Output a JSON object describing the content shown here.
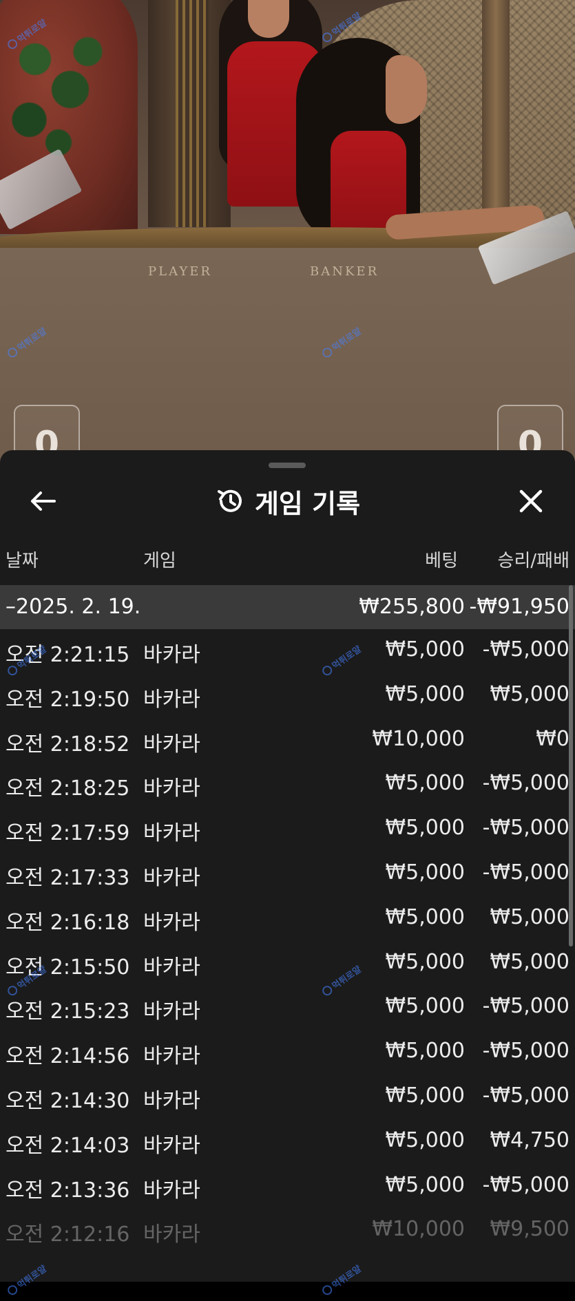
{
  "video": {
    "table_labels": {
      "player": "PLAYER",
      "banker": "BANKER"
    },
    "scores": {
      "left": "0",
      "right": "0"
    }
  },
  "watermark_text": "먹튀로얄",
  "sheet": {
    "title": "게임 기록",
    "back_icon": "arrow-left-icon",
    "history_icon": "history-icon",
    "close_icon": "close-icon",
    "columns": {
      "date": "날짜",
      "game": "게임",
      "bet": "베팅",
      "result": "승리/패배"
    },
    "date_group": {
      "date": "–2025. 2. 19.",
      "total_bet": "₩255,800",
      "total_result": "-₩91,950"
    },
    "rows": [
      {
        "time": "오전 2:21:15",
        "game": "바카라",
        "bet": "₩5,000",
        "result": "-₩5,000"
      },
      {
        "time": "오전 2:19:50",
        "game": "바카라",
        "bet": "₩5,000",
        "result": "₩5,000"
      },
      {
        "time": "오전 2:18:52",
        "game": "바카라",
        "bet": "₩10,000",
        "result": "₩0"
      },
      {
        "time": "오전 2:18:25",
        "game": "바카라",
        "bet": "₩5,000",
        "result": "-₩5,000"
      },
      {
        "time": "오전 2:17:59",
        "game": "바카라",
        "bet": "₩5,000",
        "result": "-₩5,000"
      },
      {
        "time": "오전 2:17:33",
        "game": "바카라",
        "bet": "₩5,000",
        "result": "-₩5,000"
      },
      {
        "time": "오전 2:16:18",
        "game": "바카라",
        "bet": "₩5,000",
        "result": "₩5,000"
      },
      {
        "time": "오전 2:15:50",
        "game": "바카라",
        "bet": "₩5,000",
        "result": "₩5,000"
      },
      {
        "time": "오전 2:15:23",
        "game": "바카라",
        "bet": "₩5,000",
        "result": "-₩5,000"
      },
      {
        "time": "오전 2:14:56",
        "game": "바카라",
        "bet": "₩5,000",
        "result": "-₩5,000"
      },
      {
        "time": "오전 2:14:30",
        "game": "바카라",
        "bet": "₩5,000",
        "result": "-₩5,000"
      },
      {
        "time": "오전 2:14:03",
        "game": "바카라",
        "bet": "₩5,000",
        "result": "₩4,750"
      },
      {
        "time": "오전 2:13:36",
        "game": "바카라",
        "bet": "₩5,000",
        "result": "-₩5,000"
      },
      {
        "time": "오전 2:12:16",
        "game": "바카라",
        "bet": "₩10,000",
        "result": "₩9,500"
      }
    ]
  }
}
